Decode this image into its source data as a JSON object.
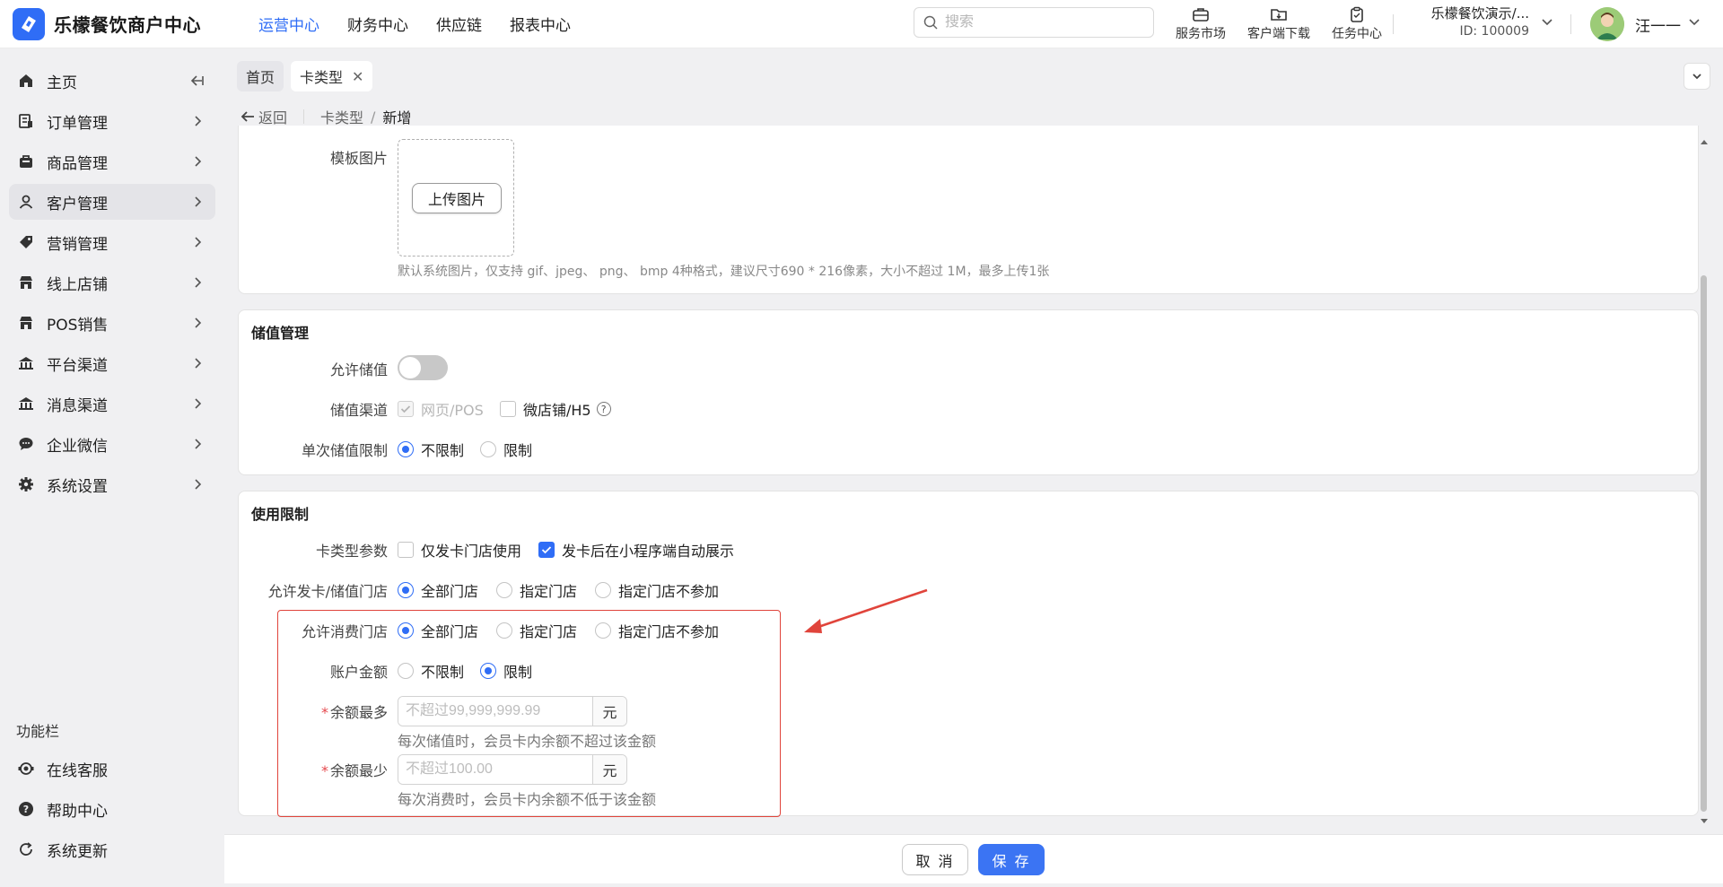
{
  "brand": {
    "name": "乐檬餐饮商户中心"
  },
  "topnav": [
    {
      "label": "运营中心",
      "active": true
    },
    {
      "label": "财务中心",
      "active": false
    },
    {
      "label": "供应链",
      "active": false
    },
    {
      "label": "报表中心",
      "active": false
    }
  ],
  "search": {
    "placeholder": "搜索"
  },
  "tools": [
    {
      "label": "服务市场",
      "icon": "briefcase-icon"
    },
    {
      "label": "客户端下载",
      "icon": "folder-download-icon"
    },
    {
      "label": "任务中心",
      "icon": "clipboard-icon"
    }
  ],
  "merchant": {
    "name": "乐檬餐饮演示/...",
    "id": "ID: 100009"
  },
  "user": {
    "name": "汪一一"
  },
  "sidebar": {
    "items": [
      {
        "label": "主页",
        "icon": "home-icon"
      },
      {
        "label": "订单管理",
        "icon": "order-icon"
      },
      {
        "label": "商品管理",
        "icon": "bag-icon"
      },
      {
        "label": "客户管理",
        "icon": "user-icon",
        "active": true
      },
      {
        "label": "营销管理",
        "icon": "tag-icon"
      },
      {
        "label": "线上店铺",
        "icon": "store-icon"
      },
      {
        "label": "POS销售",
        "icon": "pos-store-icon"
      },
      {
        "label": "平台渠道",
        "icon": "bank-icon"
      },
      {
        "label": "消息渠道",
        "icon": "bank-icon"
      },
      {
        "label": "企业微信",
        "icon": "chat-icon"
      },
      {
        "label": "系统设置",
        "icon": "gear-icon"
      }
    ],
    "section_title": "功能栏",
    "bottom_items": [
      {
        "label": "在线客服",
        "icon": "headset-icon"
      },
      {
        "label": "帮助中心",
        "icon": "help-icon"
      },
      {
        "label": "系统更新",
        "icon": "refresh-icon"
      }
    ]
  },
  "tabs": [
    {
      "label": "首页"
    },
    {
      "label": "卡类型",
      "closable": true
    }
  ],
  "breadcrumb": {
    "back": "返回",
    "parent": "卡类型",
    "current": "新增"
  },
  "template": {
    "label": "模板图片",
    "upload_button": "上传图片",
    "hint": "默认系统图片，仅支持 gif、jpeg、 png、 bmp 4种格式，建议尺寸690 * 216像素，大小不超过 1M，最多上传1张"
  },
  "stored_value": {
    "title": "储值管理",
    "allow_label": "允许储值",
    "allow_on": false,
    "channel_label": "储值渠道",
    "channels": [
      {
        "label": "网页/POS",
        "checked": true,
        "disabled": true
      },
      {
        "label": "微店铺/H5",
        "checked": false,
        "disabled": false
      }
    ],
    "limit_label": "单次储值限制",
    "limit_options": [
      {
        "label": "不限制",
        "selected": true
      },
      {
        "label": "限制",
        "selected": false
      }
    ]
  },
  "usage": {
    "title": "使用限制",
    "param_label": "卡类型参数",
    "params": [
      {
        "label": "仅发卡门店使用",
        "checked": false
      },
      {
        "label": "发卡后在小程序端自动展示",
        "checked": true
      }
    ],
    "issue_label": "允许发卡/储值门店",
    "issue_options": [
      {
        "label": "全部门店",
        "selected": true
      },
      {
        "label": "指定门店",
        "selected": false
      },
      {
        "label": "指定门店不参加",
        "selected": false
      }
    ],
    "consume_label": "允许消费门店",
    "consume_options": [
      {
        "label": "全部门店",
        "selected": true
      },
      {
        "label": "指定门店",
        "selected": false
      },
      {
        "label": "指定门店不参加",
        "selected": false
      }
    ],
    "balance_label": "账户金额",
    "balance_options": [
      {
        "label": "不限制",
        "selected": false
      },
      {
        "label": "限制",
        "selected": true
      }
    ],
    "max_label": "余额最多",
    "max_placeholder": "不超过99,999,999.99",
    "max_unit": "元",
    "max_hint": "每次储值时，会员卡内余额不超过该金额",
    "min_label": "余额最少",
    "min_placeholder": "不超过100.00",
    "min_unit": "元",
    "min_hint": "每次消费时，会员卡内余额不低于该金额"
  },
  "footer": {
    "cancel": "取 消",
    "save": "保 存"
  },
  "colors": {
    "accent": "#2f6df6",
    "highlight": "#e0443b"
  }
}
